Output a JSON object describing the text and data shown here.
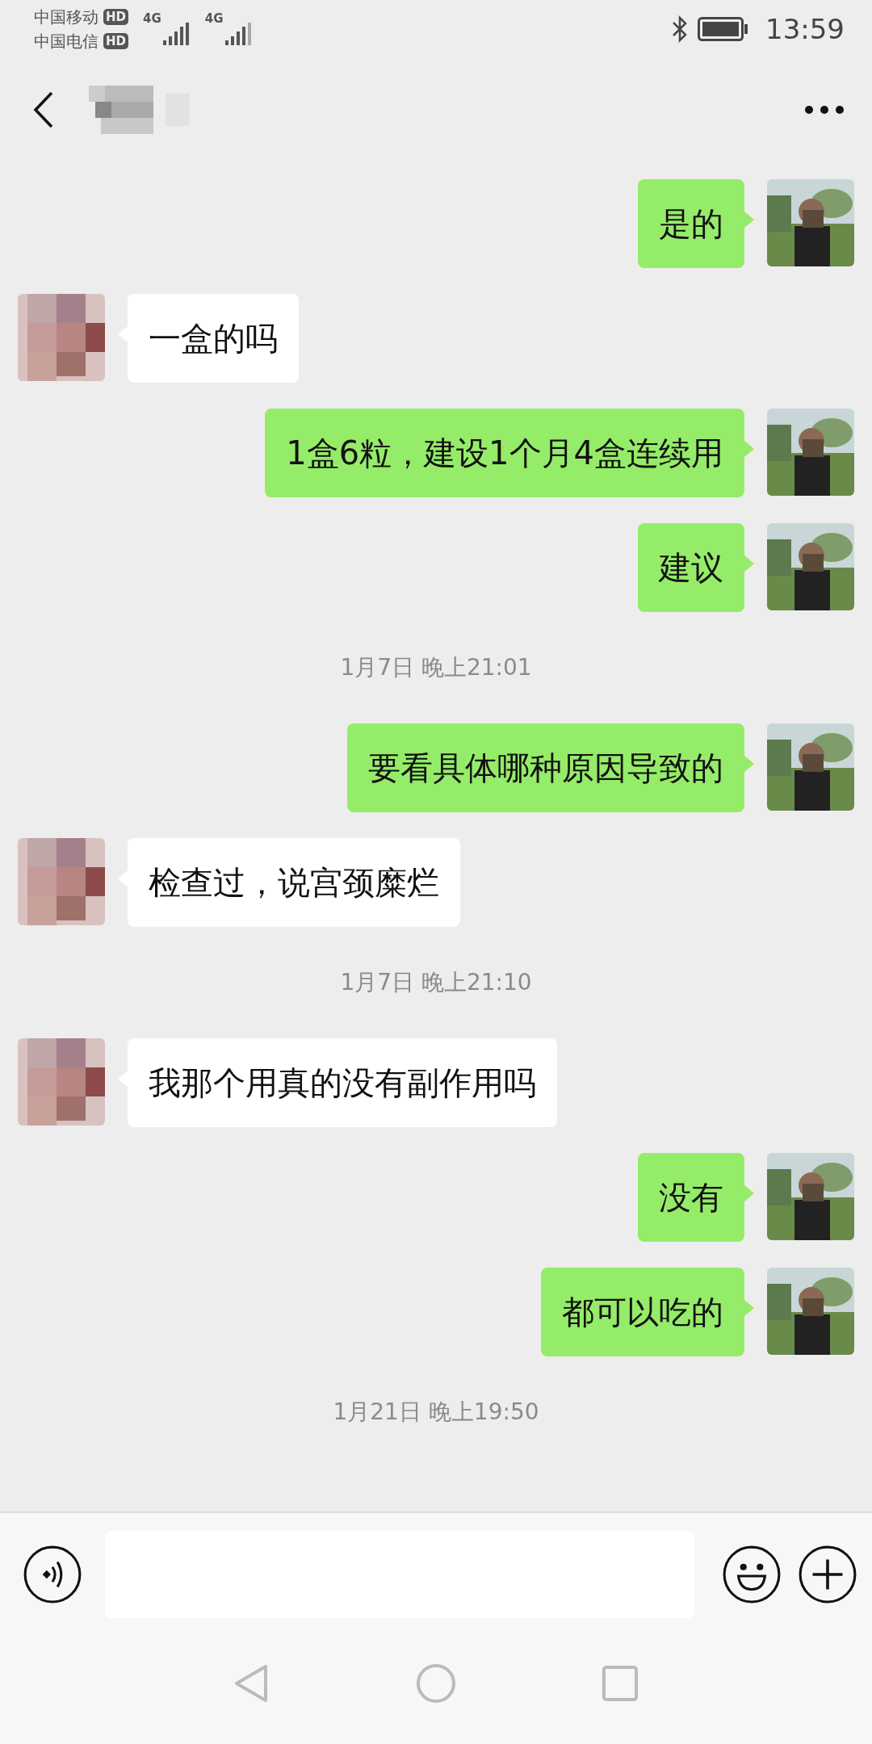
{
  "status_bar": {
    "carriers": [
      {
        "name": "中国移动",
        "badge": "HD"
      },
      {
        "name": "中国电信",
        "badge": "HD"
      }
    ],
    "network": [
      "4G",
      "4G"
    ],
    "time": "13:59"
  },
  "messages": [
    {
      "kind": "sent",
      "text": "是的"
    },
    {
      "kind": "received",
      "text": "一盒的吗"
    },
    {
      "kind": "sent",
      "text": "1盒6粒，建设1个月4盒连续用"
    },
    {
      "kind": "sent",
      "text": "建议"
    },
    {
      "kind": "time",
      "text": "1月7日 晚上21:01"
    },
    {
      "kind": "sent",
      "text": "要看具体哪种原因导致的"
    },
    {
      "kind": "received",
      "text": "检查过，说宫颈糜烂"
    },
    {
      "kind": "time",
      "text": "1月7日 晚上21:10"
    },
    {
      "kind": "received",
      "text": "我那个用真的没有副作用吗"
    },
    {
      "kind": "sent",
      "text": "没有"
    },
    {
      "kind": "sent",
      "text": "都可以吃的"
    },
    {
      "kind": "time",
      "text": "1月21日 晚上19:50"
    }
  ]
}
